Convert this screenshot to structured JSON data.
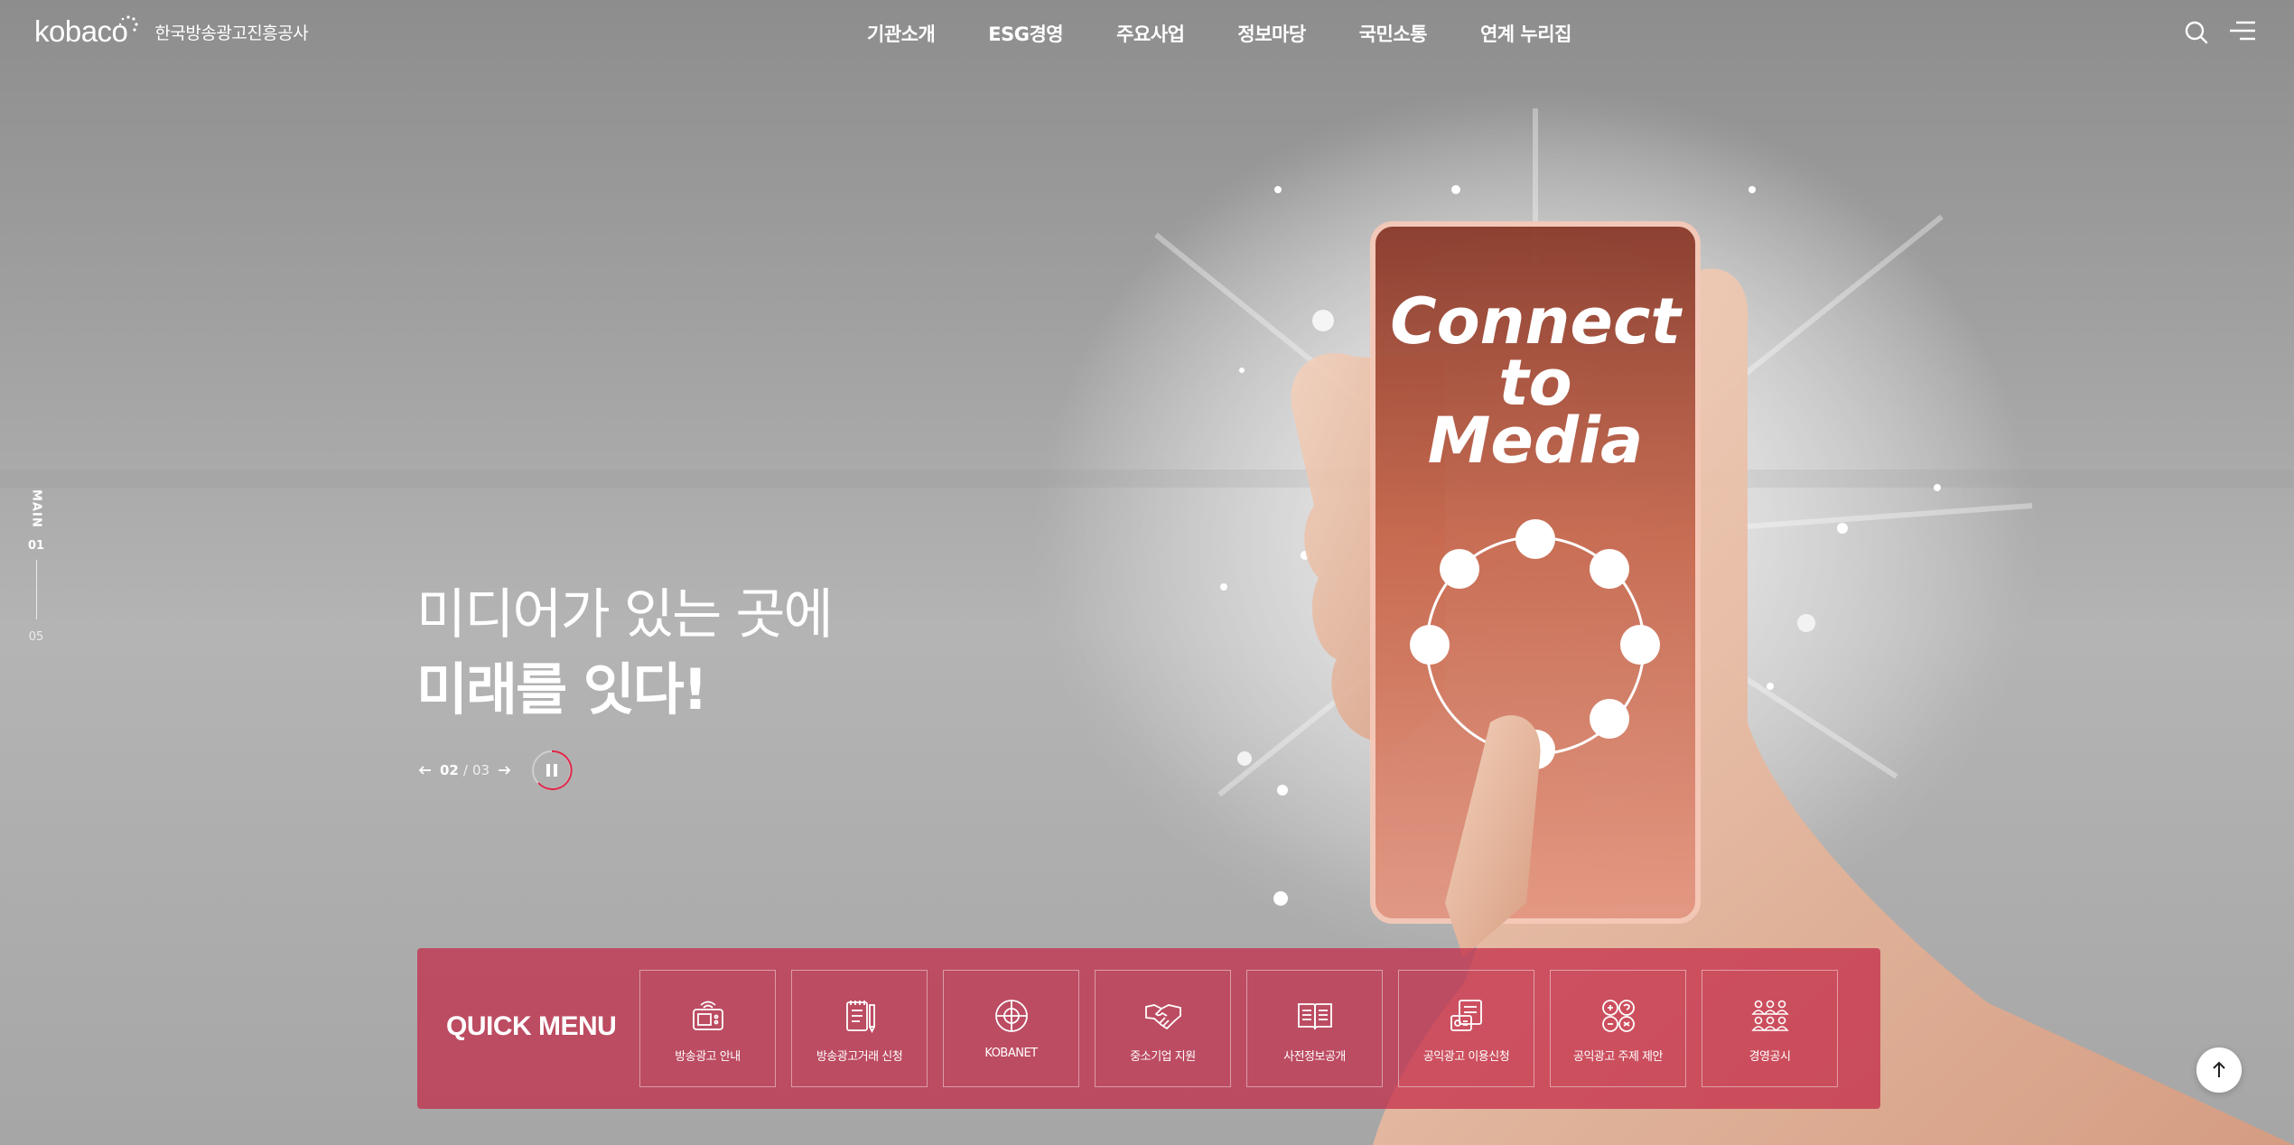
{
  "header": {
    "logo_en": "kobaco",
    "logo_ko": "한국방송광고진흥공사",
    "nav": [
      "기관소개",
      "ESG경영",
      "주요사업",
      "정보마당",
      "국민소통",
      "연계 누리집"
    ]
  },
  "hero": {
    "side_label": "MAIN",
    "side_current": "01",
    "side_total": "05",
    "slogan_line1": "미디어가 있는 곳에",
    "slogan_line2": "미래를 잇다!",
    "phone_text": [
      "Connect",
      "to",
      "Media"
    ],
    "page_current": "02",
    "page_separator": "/",
    "page_total": "03"
  },
  "quick_menu": {
    "title": "QUICK MENU",
    "items": [
      {
        "label": "방송광고 안내",
        "icon": "tv-icon"
      },
      {
        "label": "방송광고거래 신청",
        "icon": "document-pen-icon"
      },
      {
        "label": "KOBANET",
        "icon": "globe-network-icon"
      },
      {
        "label": "중소기업 지원",
        "icon": "handshake-icon"
      },
      {
        "label": "사전정보공개",
        "icon": "open-book-icon"
      },
      {
        "label": "공익광고 이용신청",
        "icon": "application-form-icon"
      },
      {
        "label": "공익광고 주제 제안",
        "icon": "idea-bubbles-icon"
      },
      {
        "label": "경영공시",
        "icon": "people-group-icon"
      }
    ]
  },
  "colors": {
    "quick_menu_bg": "#c42846",
    "pause_ring": "#e0284a"
  }
}
